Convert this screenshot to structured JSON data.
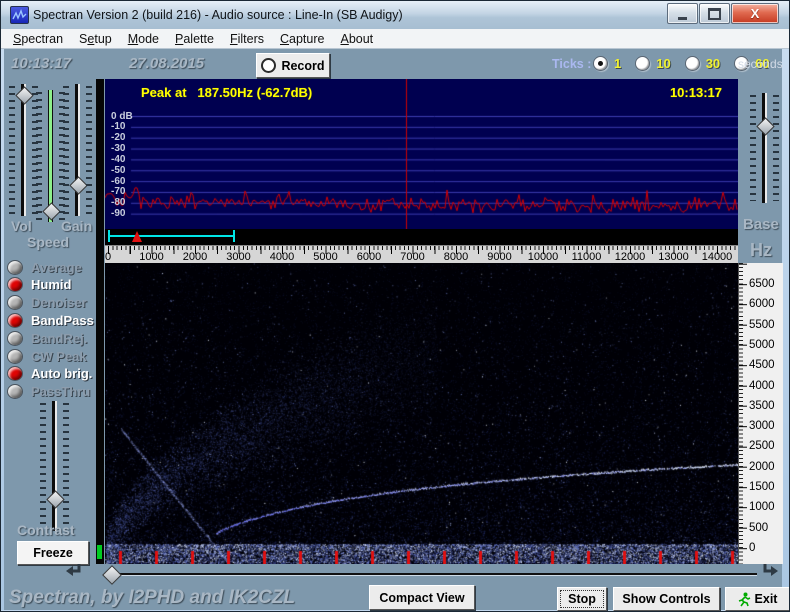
{
  "window": {
    "title": "Spectran Version 2 (build 216) - Audio source  :  Line-In (SB Audigy)"
  },
  "menu": {
    "items": [
      {
        "pre": "",
        "u": "S",
        "post": "pectran"
      },
      {
        "pre": "S",
        "u": "e",
        "post": "tup"
      },
      {
        "pre": "",
        "u": "M",
        "post": "ode"
      },
      {
        "pre": "",
        "u": "P",
        "post": "alette"
      },
      {
        "pre": "",
        "u": "F",
        "post": "ilters"
      },
      {
        "pre": "",
        "u": "C",
        "post": "apture"
      },
      {
        "pre": "",
        "u": "A",
        "post": "bout"
      }
    ]
  },
  "topbar": {
    "time": "10:13:17",
    "date": "27.08.2015",
    "record": "Record",
    "ticks_label": "Ticks :",
    "tick_options": [
      {
        "label": "1",
        "selected": true
      },
      {
        "label": "10",
        "selected": false
      },
      {
        "label": "30",
        "selected": false
      },
      {
        "label": "60",
        "selected": false
      }
    ],
    "seconds": "seconds"
  },
  "spectrum": {
    "peak_text": "Peak at   187.50Hz (-62.7dB)",
    "clock": "10:13:17",
    "db_labels": [
      "0 dB",
      "-10",
      "-20",
      "-30",
      "-40",
      "-50",
      "-60",
      "-70",
      "-80",
      "-90"
    ],
    "cursor_hz": 6850,
    "peak_hz": 187.5,
    "peak_db": -62.7
  },
  "freq_axis": {
    "labels": [
      "0",
      "1000",
      "2000",
      "3000",
      "4000",
      "5000",
      "6000",
      "7000",
      "8000",
      "9000",
      "10000",
      "11000",
      "12000",
      "13000",
      "14000"
    ]
  },
  "bandpass": {
    "low_hz": 0,
    "high_hz": 2900,
    "marker_hz": 700
  },
  "waterfall": {
    "scale_labels": [
      "6500",
      "6000",
      "5500",
      "5000",
      "4500",
      "4000",
      "3500",
      "3000",
      "2500",
      "2000",
      "1500",
      "1000",
      "500",
      "0"
    ],
    "tick_interval_seconds": 1
  },
  "left_panel": {
    "labels": {
      "vol": "Vol",
      "gain": "Gain",
      "speed": "Speed",
      "contrast": "Contrast"
    },
    "sliders": {
      "vol": 0.04,
      "speed": 0.97,
      "gain": 0.8,
      "contrast": 0.79,
      "base": 0.28
    },
    "toggles": [
      {
        "label": "Average",
        "active": false
      },
      {
        "label": "Humid",
        "active": true
      },
      {
        "label": "Denoiser",
        "active": false
      },
      {
        "label": "BandPass",
        "active": true
      },
      {
        "label": "BandRej.",
        "active": false
      },
      {
        "label": "CW Peak",
        "active": false
      },
      {
        "label": "Auto brig.",
        "active": true
      },
      {
        "label": "PassThru",
        "active": false
      }
    ],
    "freeze": "Freeze"
  },
  "right_panel": {
    "base": "Base",
    "unit": "Hz"
  },
  "statusbar": {
    "credit": "Spectran, by I2PHD and IK2CZL",
    "compact_view": "Compact View",
    "stop": "Stop",
    "show_controls": "Show Controls",
    "exit": "Exit"
  },
  "colors": {
    "accent_yellow": "#ffff00",
    "bandpass_cyan": "#00e6e6",
    "trace_red": "#d40000",
    "spectrum_bg": "#000050",
    "panel_slate": "#7e98ac"
  }
}
